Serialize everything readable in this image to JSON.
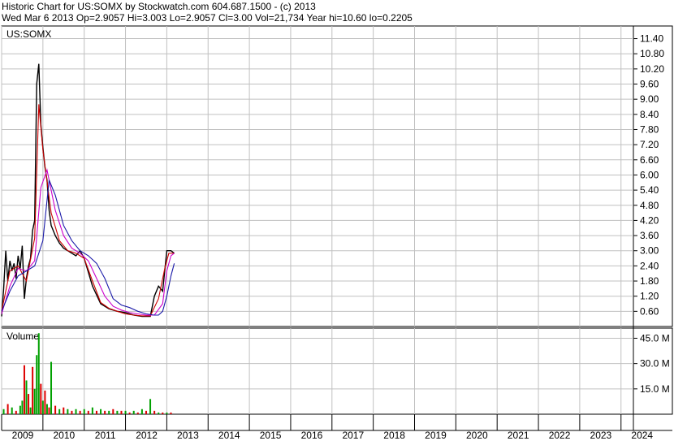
{
  "header": {
    "line1": "Historic Chart for US:SOMX by Stockwatch.com 604.687.1500 - (c) 2013",
    "line2": "Wed Mar  6 2013   Op=2.9057  Hi=3.003  Lo=2.9057  Cl=3.00   Vol=21,734   Year hi=10.60  lo=0.2205"
  },
  "colors": {
    "price": "#000000",
    "ma_short": "#cc0000",
    "ma_mid": "#cc00cc",
    "ma_long": "#1a1aa8",
    "volume_up": "#00a000",
    "volume_down": "#dd0000",
    "grid": "#c0c0c0"
  },
  "chart_data": [
    {
      "type": "line",
      "panel_label": "US:SOMX",
      "y_axis": {
        "position": "right",
        "ticks": [
          "11.40",
          "10.80",
          "10.20",
          "9.60",
          "9.00",
          "8.40",
          "7.80",
          "7.20",
          "6.60",
          "6.00",
          "5.40",
          "4.80",
          "4.20",
          "3.60",
          "3.00",
          "2.40",
          "1.80",
          "1.20",
          "0.60"
        ],
        "ylim": [
          0,
          11.9
        ]
      },
      "x_axis": {
        "ticks": [
          "2009",
          "2010",
          "2011",
          "2012",
          "2013",
          "2014",
          "2015",
          "2016",
          "2017",
          "2018",
          "2019",
          "2020",
          "2021",
          "2022",
          "2023",
          "2024"
        ]
      },
      "grid": true,
      "series": [
        {
          "role": "price",
          "x": [
            2009.0,
            2009.05,
            2009.1,
            2009.15,
            2009.2,
            2009.25,
            2009.3,
            2009.35,
            2009.4,
            2009.45,
            2009.5,
            2009.55,
            2009.6,
            2009.65,
            2009.7,
            2009.75,
            2009.8,
            2009.85,
            2009.9,
            2009.95,
            2010.0,
            2010.05,
            2010.1,
            2010.15,
            2010.2,
            2010.3,
            2010.4,
            2010.5,
            2010.6,
            2010.7,
            2010.8,
            2010.9,
            2011.0,
            2011.2,
            2011.4,
            2011.6,
            2011.8,
            2012.0,
            2012.2,
            2012.4,
            2012.6,
            2012.7,
            2012.8,
            2012.9,
            2013.0,
            2013.1,
            2013.18
          ],
          "values": [
            0.4,
            1.5,
            3.0,
            1.8,
            2.6,
            2.2,
            2.5,
            1.9,
            2.8,
            2.3,
            3.2,
            1.1,
            1.9,
            2.4,
            2.7,
            3.8,
            4.2,
            9.6,
            10.4,
            8.0,
            7.1,
            6.3,
            5.8,
            4.6,
            4.0,
            3.6,
            3.3,
            3.1,
            3.0,
            2.9,
            2.8,
            3.0,
            2.7,
            1.6,
            0.9,
            0.7,
            0.6,
            0.55,
            0.45,
            0.4,
            0.4,
            1.2,
            1.6,
            1.4,
            3.0,
            3.0,
            2.9
          ]
        },
        {
          "role": "moving-average-short",
          "x": [
            2009.0,
            2009.2,
            2009.4,
            2009.6,
            2009.8,
            2009.9,
            2010.0,
            2010.2,
            2010.4,
            2010.6,
            2010.8,
            2011.0,
            2011.2,
            2011.4,
            2011.6,
            2011.8,
            2012.0,
            2012.2,
            2012.4,
            2012.6,
            2012.8,
            2012.95,
            2013.05,
            2013.18
          ],
          "values": [
            0.6,
            2.2,
            2.4,
            1.8,
            3.5,
            8.8,
            7.0,
            4.5,
            3.4,
            3.0,
            2.9,
            2.7,
            1.8,
            0.95,
            0.72,
            0.6,
            0.5,
            0.45,
            0.42,
            0.42,
            1.1,
            2.3,
            2.9,
            2.9
          ]
        },
        {
          "role": "moving-average-mid",
          "x": [
            2009.0,
            2009.2,
            2009.4,
            2009.6,
            2009.8,
            2009.95,
            2010.1,
            2010.3,
            2010.5,
            2010.7,
            2010.9,
            2011.1,
            2011.3,
            2011.5,
            2011.7,
            2011.9,
            2012.1,
            2012.3,
            2012.5,
            2012.7,
            2012.9,
            2013.0,
            2013.1,
            2013.18
          ],
          "values": [
            0.5,
            1.6,
            2.3,
            2.2,
            2.6,
            5.5,
            6.2,
            4.6,
            3.6,
            3.1,
            2.9,
            2.6,
            1.9,
            1.2,
            0.8,
            0.65,
            0.55,
            0.5,
            0.45,
            0.45,
            0.9,
            2.2,
            2.8,
            2.9
          ]
        },
        {
          "role": "moving-average-long",
          "x": [
            2009.0,
            2009.2,
            2009.4,
            2009.6,
            2009.8,
            2010.0,
            2010.15,
            2010.3,
            2010.5,
            2010.7,
            2010.9,
            2011.1,
            2011.3,
            2011.5,
            2011.7,
            2011.9,
            2012.1,
            2012.3,
            2012.5,
            2012.7,
            2012.8,
            2012.9,
            2013.0,
            2013.1,
            2013.18
          ],
          "values": [
            0.6,
            1.4,
            2.0,
            2.2,
            2.4,
            3.4,
            5.8,
            5.2,
            4.0,
            3.4,
            3.0,
            2.8,
            2.5,
            1.9,
            1.1,
            0.85,
            0.75,
            0.6,
            0.5,
            0.45,
            0.45,
            0.6,
            1.2,
            2.0,
            2.5
          ]
        }
      ]
    },
    {
      "type": "bar",
      "panel_label": "Volume",
      "y_axis": {
        "position": "right",
        "ticks": [
          "45.0 M",
          "30.0 M",
          "15.0 M"
        ],
        "ylim": [
          0,
          51
        ]
      },
      "x": [
        2009.05,
        2009.15,
        2009.25,
        2009.35,
        2009.45,
        2009.5,
        2009.55,
        2009.6,
        2009.65,
        2009.7,
        2009.75,
        2009.8,
        2009.85,
        2009.9,
        2009.95,
        2010.0,
        2010.05,
        2010.1,
        2010.15,
        2010.2,
        2010.3,
        2010.4,
        2010.5,
        2010.6,
        2010.7,
        2010.8,
        2010.9,
        2011.0,
        2011.1,
        2011.2,
        2011.3,
        2011.4,
        2011.5,
        2011.6,
        2011.7,
        2011.8,
        2011.9,
        2012.0,
        2012.1,
        2012.2,
        2012.3,
        2012.4,
        2012.5,
        2012.6,
        2012.7,
        2012.8,
        2012.9,
        2013.0,
        2013.1
      ],
      "values": [
        3,
        6,
        4,
        2,
        5,
        8,
        29,
        20,
        12,
        4,
        28,
        15,
        35,
        48,
        18,
        8,
        14,
        6,
        4,
        31,
        5,
        3,
        4,
        3,
        2,
        3,
        2,
        3,
        2,
        4,
        2,
        3,
        2,
        2,
        3,
        2,
        2,
        2,
        1,
        2,
        1,
        3,
        2,
        9,
        2,
        1,
        1,
        1,
        1
      ],
      "up": [
        1,
        0,
        1,
        0,
        1,
        1,
        0,
        1,
        0,
        1,
        0,
        1,
        1,
        1,
        0,
        1,
        0,
        1,
        0,
        1,
        0,
        1,
        0,
        1,
        0,
        1,
        0,
        1,
        0,
        1,
        0,
        1,
        0,
        1,
        0,
        1,
        0,
        1,
        0,
        1,
        0,
        1,
        0,
        1,
        0,
        1,
        0,
        1,
        0
      ]
    }
  ]
}
